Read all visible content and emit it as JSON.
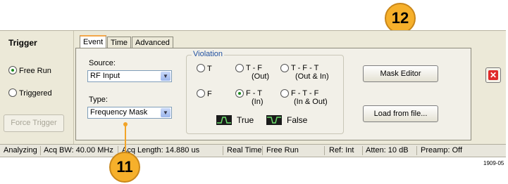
{
  "left": {
    "title": "Trigger",
    "free_run": "Free Run",
    "triggered": "Triggered",
    "force_trigger": "Force Trigger"
  },
  "tabs": [
    "Event",
    "Time",
    "Advanced"
  ],
  "event": {
    "source_label": "Source:",
    "source_value": "RF Input",
    "type_label": "Type:",
    "type_value": "Frequency Mask"
  },
  "violation": {
    "title": "Violation",
    "opt_t": "T",
    "opt_tf_1": "T - F",
    "opt_tf_2": "(Out)",
    "opt_tft_1": "T - F - T",
    "opt_tft_2": "(Out & In)",
    "opt_f": "F",
    "opt_ft_1": "F - T",
    "opt_ft_2": "(In)",
    "opt_ftf_1": "F - T - F",
    "opt_ftf_2": "(In & Out)",
    "legend_true": "True",
    "legend_false": "False"
  },
  "buttons": {
    "mask_editor": "Mask Editor",
    "load_from_file": "Load from file..."
  },
  "close_glyph": "✕",
  "status": {
    "analyzing": "Analyzing",
    "acq_bw": "Acq BW: 40.00 MHz",
    "acq_length": "Acq Length: 14.880 us",
    "real_time": "Real Time",
    "free_run": "Free Run",
    "ref": "Ref: Int",
    "atten": "Atten: 10 dB",
    "preamp": "Preamp: Off"
  },
  "callouts": {
    "c12": "12",
    "c11": "11"
  },
  "figure_id": "1909-05",
  "colors": {
    "callout": "#f6b02b",
    "true_icon": "#1a1a1a",
    "accent": "#f3a64a"
  }
}
